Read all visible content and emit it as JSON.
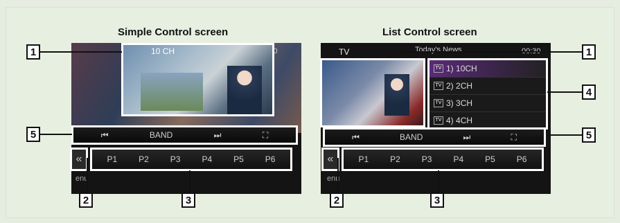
{
  "left_screen": {
    "title": "Simple Control screen",
    "channel": "10 CH",
    "clock": "00:30",
    "controls": {
      "prev": "⏮",
      "band": "BAND",
      "next": "⏭",
      "expand": "⛶"
    },
    "presets": [
      "P1",
      "P2",
      "P3",
      "P4",
      "P5",
      "P6"
    ],
    "back": "«",
    "menu": "enu"
  },
  "right_screen": {
    "title": "List Control screen",
    "source": "TV",
    "news": "Today's News",
    "clock": "00:30",
    "channels": [
      {
        "num": "1)",
        "name": "10CH"
      },
      {
        "num": "2)",
        "name": "2CH"
      },
      {
        "num": "3)",
        "name": "3CH"
      },
      {
        "num": "4)",
        "name": "4CH"
      }
    ],
    "controls": {
      "prev": "⏮",
      "band": "BAND",
      "next": "⏭",
      "expand": "⛶"
    },
    "presets": [
      "P1",
      "P2",
      "P3",
      "P4",
      "P5",
      "P6"
    ],
    "back": "«",
    "menu": "enu"
  },
  "callouts": {
    "c1": "1",
    "c2": "2",
    "c3": "3",
    "c4": "4",
    "c5": "5"
  }
}
